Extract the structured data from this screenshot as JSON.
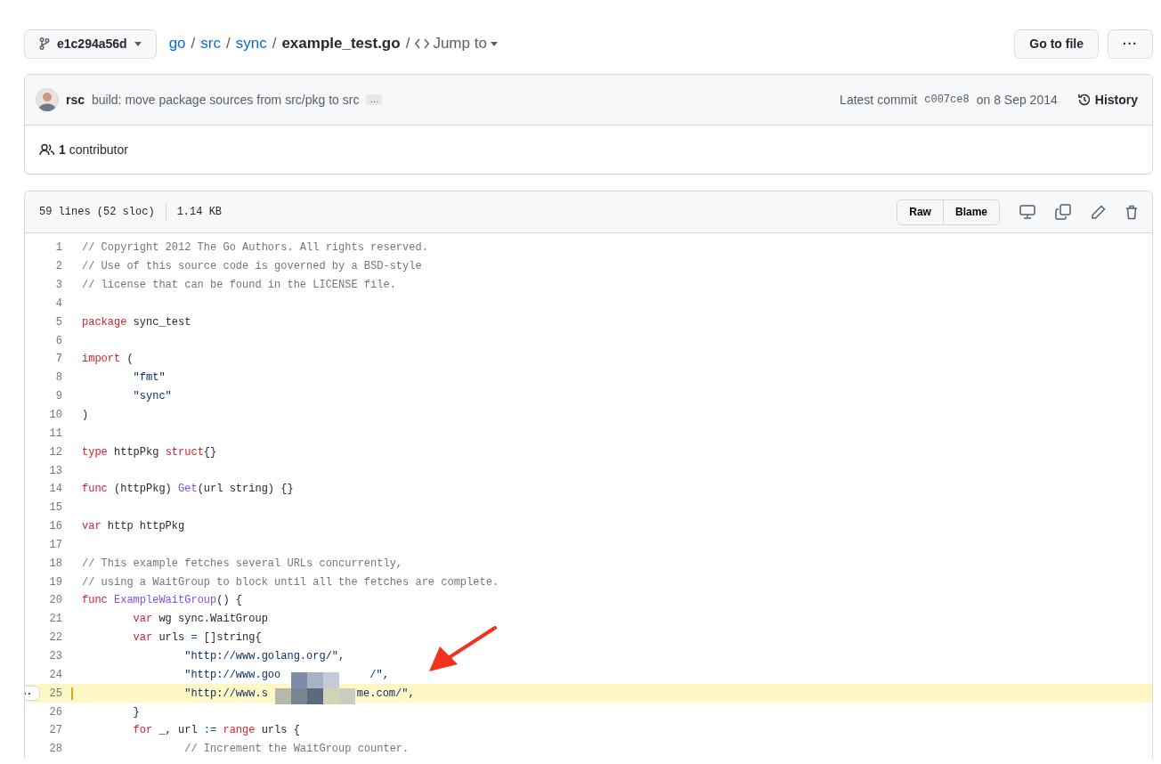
{
  "branch": {
    "label": "e1c294a56d"
  },
  "breadcrumb": [
    {
      "label": "go",
      "kind": "link"
    },
    {
      "label": "/",
      "kind": "separator"
    },
    {
      "label": "src",
      "kind": "link"
    },
    {
      "label": "/",
      "kind": "separator"
    },
    {
      "label": "sync",
      "kind": "link"
    },
    {
      "label": "/",
      "kind": "separator"
    },
    {
      "label": "example_test.go",
      "kind": "current"
    },
    {
      "label": "/",
      "kind": "separator"
    }
  ],
  "jump_to": "Jump to",
  "actions": {
    "go_to_file": "Go to file",
    "more": "···"
  },
  "commit": {
    "author": "rsc",
    "message": "build: move package sources from src/pkg to src",
    "ellipsis": "…",
    "latest_label": "Latest commit",
    "sha": "c007ce8",
    "date": "on 8 Sep 2014",
    "history": "History"
  },
  "contributors": {
    "count": "1",
    "label": "contributor"
  },
  "file": {
    "lines_info": "59 lines (52 sloc)",
    "size": "1.14 KB",
    "buttons": [
      "Raw",
      "Blame"
    ]
  },
  "code": [
    {
      "n": "1",
      "highlighted": false,
      "tokens": [
        {
          "kind": "comment",
          "text": "// Copyright 2012 The Go Authors. All rights reserved."
        }
      ]
    },
    {
      "n": "2",
      "highlighted": false,
      "tokens": [
        {
          "kind": "comment",
          "text": "// Use of this source code is governed by a BSD-style"
        }
      ]
    },
    {
      "n": "3",
      "highlighted": false,
      "tokens": [
        {
          "kind": "comment",
          "text": "// license that can be found in the LICENSE file."
        }
      ]
    },
    {
      "n": "4",
      "highlighted": false
    },
    {
      "n": "5",
      "highlighted": false,
      "tokens": [
        {
          "kind": "keyword",
          "text": "package"
        },
        {
          "kind": "plain",
          "text": " sync_test"
        }
      ]
    },
    {
      "n": "6",
      "highlighted": false
    },
    {
      "n": "7",
      "highlighted": false,
      "tokens": [
        {
          "kind": "keyword",
          "text": "import"
        },
        {
          "kind": "plain",
          "text": " ("
        }
      ]
    },
    {
      "n": "8",
      "highlighted": false,
      "tokens": [
        {
          "kind": "string",
          "text": "\t\"fmt\""
        }
      ]
    },
    {
      "n": "9",
      "highlighted": false,
      "tokens": [
        {
          "kind": "string",
          "text": "\t\"sync\""
        }
      ]
    },
    {
      "n": "10",
      "highlighted": false,
      "tokens": [
        {
          "kind": "plain",
          "text": ")"
        }
      ]
    },
    {
      "n": "11",
      "highlighted": false
    },
    {
      "n": "12",
      "highlighted": false,
      "tokens": [
        {
          "kind": "keyword",
          "text": "type"
        },
        {
          "kind": "plain",
          "text": " httpPkg "
        },
        {
          "kind": "keyword",
          "text": "struct"
        },
        {
          "kind": "plain",
          "text": "{}"
        }
      ]
    },
    {
      "n": "13",
      "highlighted": false
    },
    {
      "n": "14",
      "highlighted": false,
      "tokens": [
        {
          "kind": "keyword",
          "text": "func"
        },
        {
          "kind": "plain",
          "text": " (httpPkg) "
        },
        {
          "kind": "function",
          "text": "Get"
        },
        {
          "kind": "plain",
          "text": "(url string) {}"
        }
      ]
    },
    {
      "n": "15",
      "highlighted": false
    },
    {
      "n": "16",
      "highlighted": false,
      "tokens": [
        {
          "kind": "keyword",
          "text": "var"
        },
        {
          "kind": "plain",
          "text": " http httpPkg"
        }
      ]
    },
    {
      "n": "17",
      "highlighted": false
    },
    {
      "n": "18",
      "highlighted": false,
      "tokens": [
        {
          "kind": "comment",
          "text": "// This example fetches several URLs concurrently,"
        }
      ]
    },
    {
      "n": "19",
      "highlighted": false,
      "tokens": [
        {
          "kind": "comment",
          "text": "// using a WaitGroup to block until all the fetches are complete."
        }
      ]
    },
    {
      "n": "20",
      "highlighted": false,
      "tokens": [
        {
          "kind": "keyword",
          "text": "func"
        },
        {
          "kind": "function",
          "text": " ExampleWaitGroup"
        },
        {
          "kind": "plain",
          "text": "() {"
        }
      ]
    },
    {
      "n": "21",
      "highlighted": false,
      "tokens": [
        {
          "kind": "keyword",
          "text": "\tvar"
        },
        {
          "kind": "plain",
          "text": " wg sync.WaitGroup"
        }
      ]
    },
    {
      "n": "22",
      "highlighted": false,
      "tokens": [
        {
          "kind": "keyword",
          "text": "\tvar"
        },
        {
          "kind": "plain",
          "text": " urls "
        },
        {
          "kind": "operator",
          "text": "="
        },
        {
          "kind": "plain",
          "text": " []string{"
        }
      ]
    },
    {
      "n": "23",
      "highlighted": false,
      "tokens": [
        {
          "kind": "string",
          "text": "\t\t\"http://www.golang.org/\""
        },
        {
          "kind": "plain",
          "text": ","
        }
      ]
    },
    {
      "n": "24",
      "highlighted": false,
      "tokens": [
        {
          "kind": "string",
          "text": "\t\t\"http://www.goo"
        },
        {
          "kind": "blur"
        },
        {
          "kind": "string",
          "text": "/\""
        },
        {
          "kind": "plain",
          "text": ","
        }
      ]
    },
    {
      "n": "25",
      "highlighted": true,
      "tokens": [
        {
          "kind": "string",
          "text": "\t\t\"http://www.s"
        },
        {
          "kind": "blur"
        },
        {
          "kind": "string",
          "text": "me.com/\""
        },
        {
          "kind": "plain",
          "text": ","
        }
      ]
    },
    {
      "n": "26",
      "highlighted": false,
      "tokens": [
        {
          "kind": "plain",
          "text": "\t}"
        }
      ]
    },
    {
      "n": "27",
      "highlighted": false,
      "tokens": [
        {
          "kind": "keyword",
          "text": "\tfor"
        },
        {
          "kind": "plain",
          "text": " _, url "
        },
        {
          "kind": "operator",
          "text": ":="
        },
        {
          "kind": "keyword",
          "text": " range"
        },
        {
          "kind": "plain",
          "text": " urls {"
        }
      ]
    },
    {
      "n": "28",
      "highlighted": false,
      "tokens": [
        {
          "kind": "comment",
          "text": "\t\t// Increment the WaitGroup counter."
        }
      ]
    }
  ]
}
